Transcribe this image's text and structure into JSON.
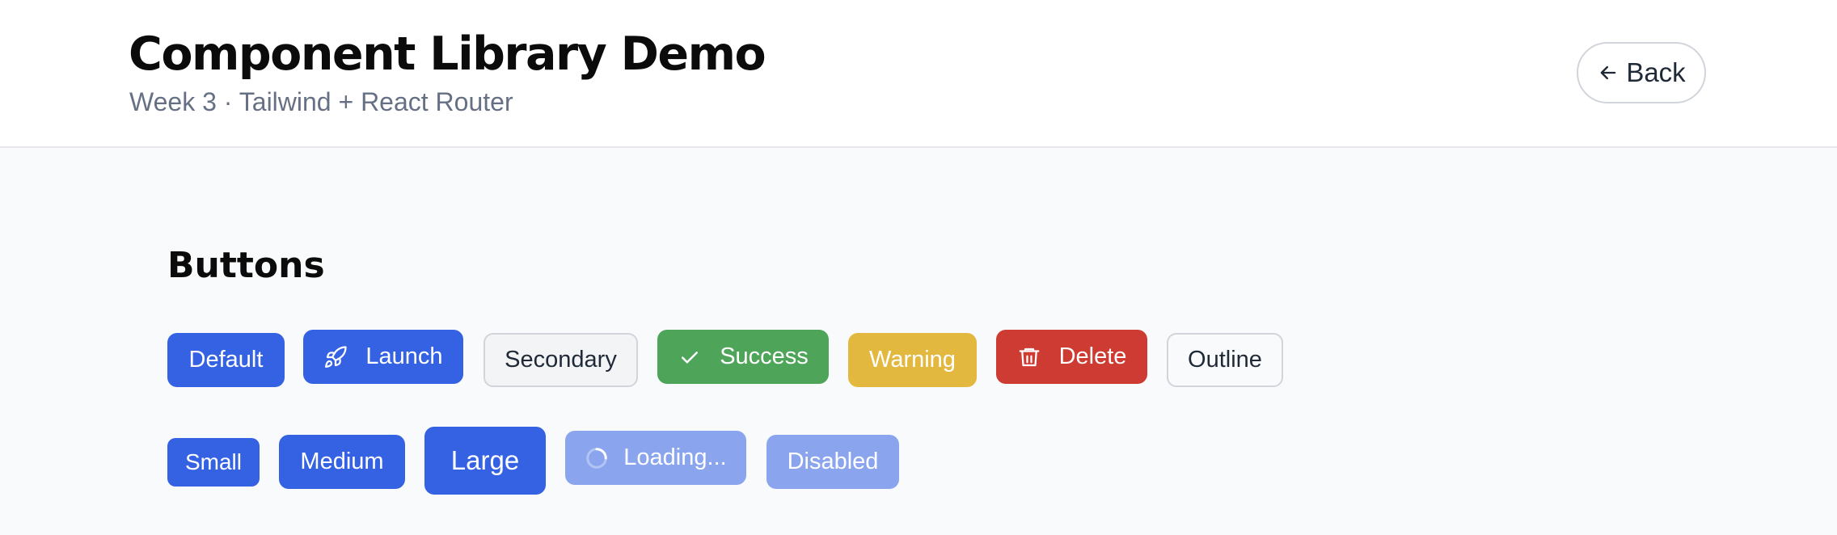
{
  "header": {
    "title": "Component Library Demo",
    "subtitle": "Week 3 · Tailwind + React Router",
    "back_label": "Back"
  },
  "section": {
    "title": "Buttons"
  },
  "variants": {
    "default": "Default",
    "launch": "Launch",
    "secondary": "Secondary",
    "success": "Success",
    "warning": "Warning",
    "delete": "Delete",
    "outline": "Outline"
  },
  "sizes": {
    "small": "Small",
    "medium": "Medium",
    "large": "Large",
    "loading": "Loading...",
    "disabled": "Disabled"
  },
  "icons": {
    "back": "arrow-left-icon",
    "launch": "rocket-icon",
    "success": "check-icon",
    "delete": "trash-icon",
    "loading": "spinner-icon"
  },
  "colors": {
    "primary": "#3562e3",
    "success": "#4ea55a",
    "warning": "#e3b83f",
    "danger": "#ce3b33",
    "primary_disabled": "#8aa5ee"
  }
}
